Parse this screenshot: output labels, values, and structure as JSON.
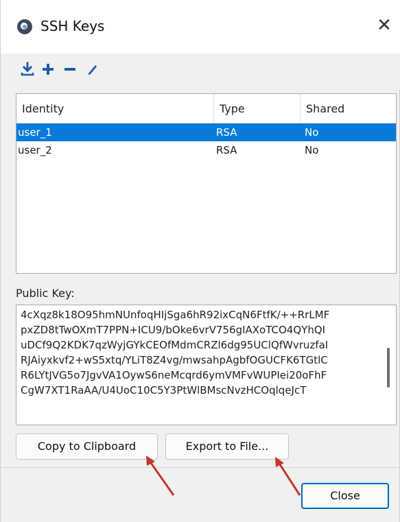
{
  "window": {
    "title": "SSH Keys",
    "close_glyph": "✕"
  },
  "toolbar": {
    "icons": [
      "import-icon",
      "add-icon",
      "remove-icon",
      "edit-icon"
    ],
    "accent": "#1e5aa8"
  },
  "table": {
    "headers": [
      "Identity",
      "Type",
      "Shared"
    ],
    "rows": [
      {
        "identity": "user_1",
        "type": "RSA",
        "shared": "No",
        "selected": true
      },
      {
        "identity": "user_2",
        "type": "RSA",
        "shared": "No",
        "selected": false
      }
    ],
    "selection_color": "#0a7ad8"
  },
  "public_key": {
    "label": "Public Key:",
    "lines": [
      "4cXqz8k18O95hmNUnfoqHIjSga6hR92ixCqN6FtfK/++RrLMF",
      "pxZD8tTwOXmT7PPN+ICU9/bOke6vrV756gIAXoTCO4QYhQI",
      "uDCf9Q2KDK7qzWyjGYkCEOfMdmCRZl6dg95UClQfWvruzfaI",
      "RJAiyxkvf2+wS5xtq/YLiT8Z4vg/mwsahpAgbfOGUCFK6TGtlC",
      "R6LYtJVG5o7JgvVA1OywS6neMcqrd6ymVMFvWUPIei20oFhF",
      "CgW7XT1RaAA/U4UoC10C5Y3PtWlBMscNvzHCOqlqeJcT"
    ]
  },
  "buttons": {
    "copy": "Copy to Clipboard",
    "export": "Export to File...",
    "close": "Close"
  },
  "annotation_color": "#c0392b"
}
